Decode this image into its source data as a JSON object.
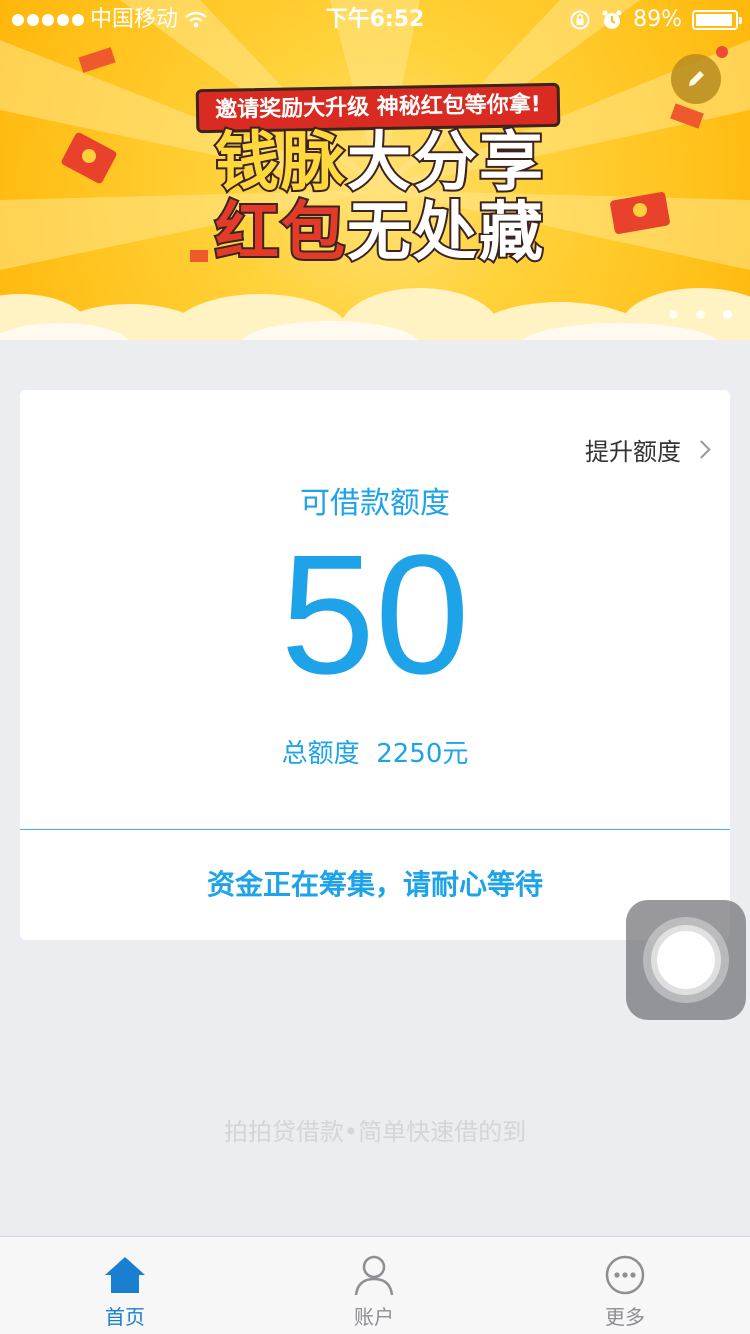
{
  "status_bar": {
    "carrier": "中国移动",
    "time": "下午6:52",
    "battery": "89%"
  },
  "banner": {
    "ribbon": "邀请奖励大升级  神秘红包等你拿!",
    "title_line1_a": "钱脉",
    "title_line1_b": "大分享",
    "title_line2_a": "红包",
    "title_line2_b": "无处藏",
    "page_count": 3,
    "active_page": 1
  },
  "card": {
    "raise_limit": "提升额度",
    "available_label": "可借款额度",
    "available_amount": "50",
    "total_label": "总额度",
    "total_amount": "2250元",
    "status_message": "资金正在筹集，请耐心等待"
  },
  "footer": {
    "slogan": "拍拍贷借款•简单快速借的到"
  },
  "tabbar": {
    "items": [
      {
        "label": "首页",
        "icon": "home-icon",
        "active": true
      },
      {
        "label": "账户",
        "icon": "user-icon",
        "active": false
      },
      {
        "label": "更多",
        "icon": "more-icon",
        "active": false
      }
    ]
  },
  "colors": {
    "accent": "#1ea3e8",
    "tab_active": "#1a7fd0",
    "banner_yellow": "#ffc21c",
    "ribbon_red": "#d92b21"
  }
}
